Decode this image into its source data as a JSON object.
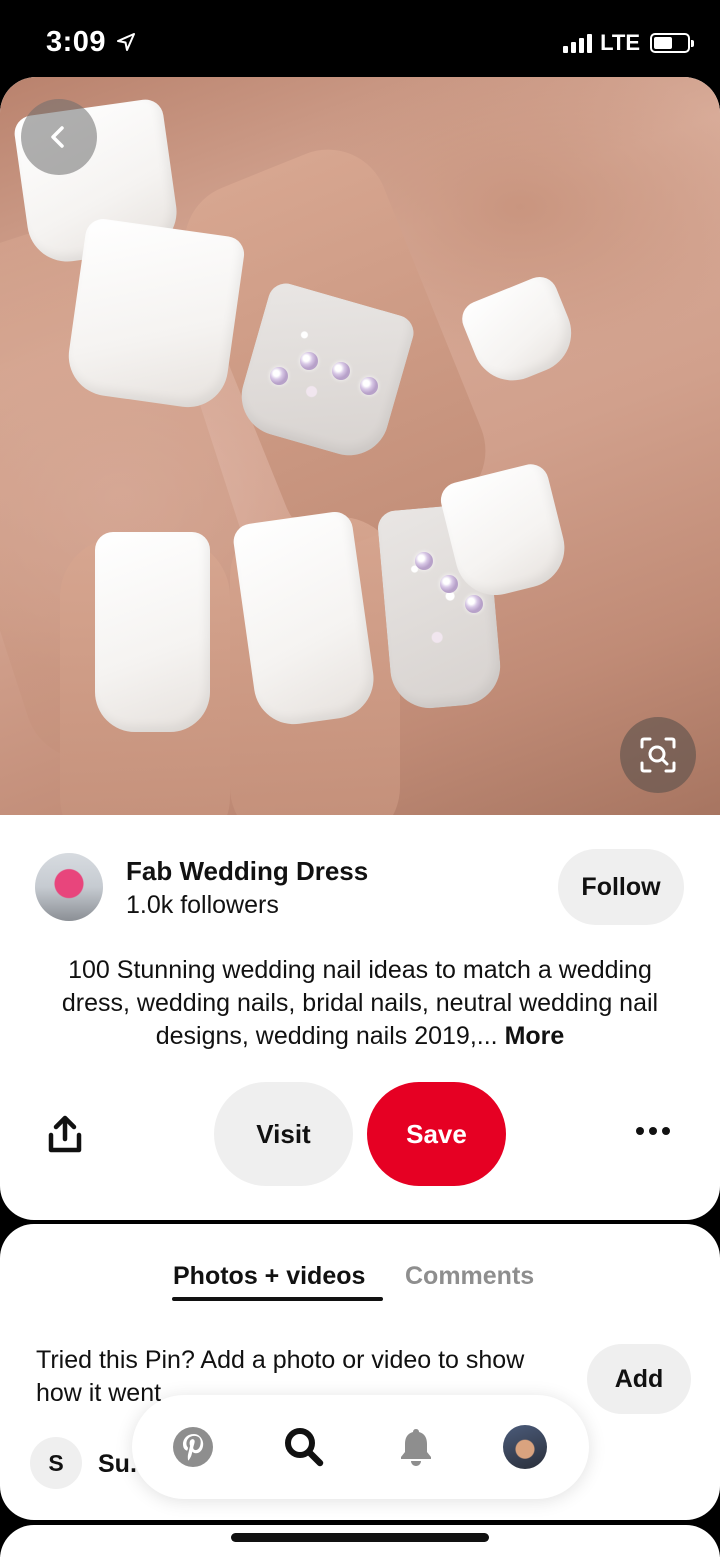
{
  "status_bar": {
    "time": "3:09",
    "network": "LTE",
    "location_icon": "location-arrow-icon",
    "signal_icon": "cellular-signal-icon",
    "battery_icon": "battery-icon"
  },
  "pin": {
    "image_alt": "white square nails with crystal accent",
    "back_icon": "chevron-left-icon",
    "visual_search_icon": "visual-search-icon"
  },
  "creator": {
    "name": "Fab Wedding Dress",
    "followers": "1.0k followers",
    "follow_label": "Follow"
  },
  "description": {
    "text": "100 Stunning wedding nail ideas to match a wedding dress, wedding nails, bridal nails, neutral wedding nail designs, wedding nails 2019,...",
    "more_label": "More"
  },
  "actions": {
    "share_icon": "share-icon",
    "visit_label": "Visit",
    "save_label": "Save",
    "more_icon": "more-options-icon"
  },
  "photos_section": {
    "tabs": [
      {
        "label": "Photos + videos",
        "active": true
      },
      {
        "label": "Comments",
        "active": false
      }
    ],
    "tried_text": "Tried this Pin? Add a photo or video to show how it went",
    "add_label": "Add",
    "comment_initial": "S",
    "comment_name": "Su."
  },
  "bottom_nav": {
    "items": [
      "pinterest-home-icon",
      "search-icon",
      "notifications-bell-icon",
      "profile-avatar"
    ]
  },
  "colors": {
    "save_red": "#e60023",
    "button_gray": "#efefef",
    "inactive_tab": "#8e8e8e"
  }
}
